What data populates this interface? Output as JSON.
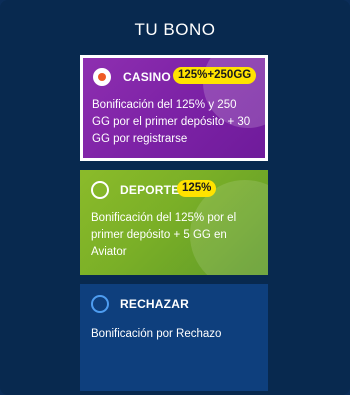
{
  "title": "TU BONO",
  "options": [
    {
      "id": "casino",
      "label": "CASINO",
      "badge": "125%+250GG",
      "description": "Bonificación del 125% y 250 GG por el primer depósito + 30 GG por registrarse",
      "selected": true
    },
    {
      "id": "deporte",
      "label": "DEPORTE",
      "badge": "125%",
      "description": "Bonificación del 125% por el primer depósito + 5 GG en Aviator",
      "selected": false
    },
    {
      "id": "rechazar",
      "label": "RECHAZAR",
      "description": "Bonificación por Rechazo",
      "selected": false
    }
  ],
  "colors": {
    "background": "#08294f",
    "casino_card": "#8e2fb0",
    "deporte_card": "#7aaf27",
    "rechazar_card": "#0e3f7d",
    "badge": "#ffe300",
    "selected_dot": "#ee5a24",
    "rechazar_radio": "#4e9df0"
  }
}
